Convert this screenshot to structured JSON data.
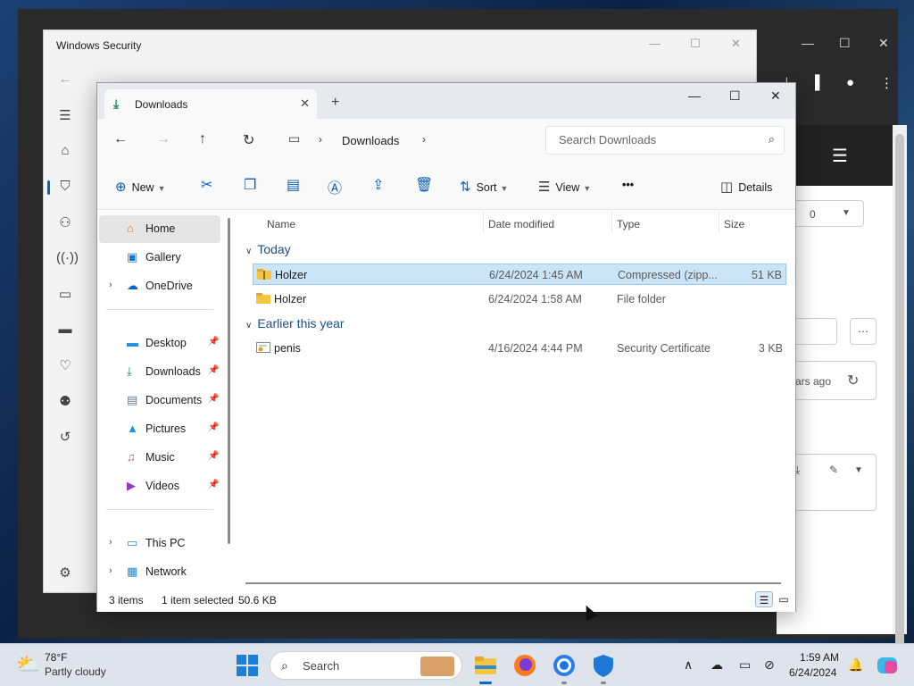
{
  "background_browser": {
    "visible_fragments": [
      "0",
      "ars ago"
    ]
  },
  "windows_security": {
    "title": "Windows Security"
  },
  "explorer": {
    "tab_label": "Downloads",
    "breadcrumb": [
      "Downloads"
    ],
    "search_placeholder": "Search Downloads",
    "commands": {
      "new": "New",
      "sort": "Sort",
      "view": "View",
      "details": "Details",
      "more": "•••"
    },
    "sidebar": {
      "top": [
        {
          "label": "Home",
          "icon": "home-icon"
        },
        {
          "label": "Gallery",
          "icon": "gallery-icon"
        },
        {
          "label": "OneDrive",
          "icon": "cloud-icon"
        }
      ],
      "pinned": [
        {
          "label": "Desktop",
          "icon": "desktop-icon"
        },
        {
          "label": "Downloads",
          "icon": "download-icon"
        },
        {
          "label": "Documents",
          "icon": "document-icon"
        },
        {
          "label": "Pictures",
          "icon": "pictures-icon"
        },
        {
          "label": "Music",
          "icon": "music-icon"
        },
        {
          "label": "Videos",
          "icon": "videos-icon"
        }
      ],
      "bottom": [
        {
          "label": "This PC",
          "icon": "pc-icon"
        },
        {
          "label": "Network",
          "icon": "network-icon"
        }
      ]
    },
    "columns": {
      "name": "Name",
      "date": "Date modified",
      "type": "Type",
      "size": "Size"
    },
    "groups": [
      {
        "label": "Today",
        "files": [
          {
            "name": "Holzer",
            "date": "6/24/2024 1:45 AM",
            "type": "Compressed (zipp...",
            "size": "51 KB",
            "icon": "zip-folder-icon"
          },
          {
            "name": "Holzer",
            "date": "6/24/2024 1:58 AM",
            "type": "File folder",
            "size": "",
            "icon": "folder-icon"
          }
        ]
      },
      {
        "label": "Earlier this year",
        "files": [
          {
            "name": "penis",
            "date": "4/16/2024 4:44 PM",
            "type": "Security Certificate",
            "size": "3 KB",
            "icon": "certificate-icon"
          }
        ]
      }
    ],
    "status": {
      "count": "3 items",
      "selection": "1 item selected",
      "selection_size": "50.6 KB"
    }
  },
  "taskbar": {
    "weather_temp": "78°F",
    "weather_desc": "Partly cloudy",
    "search_placeholder": "Search",
    "time": "1:59 AM",
    "date": "6/24/2024"
  }
}
